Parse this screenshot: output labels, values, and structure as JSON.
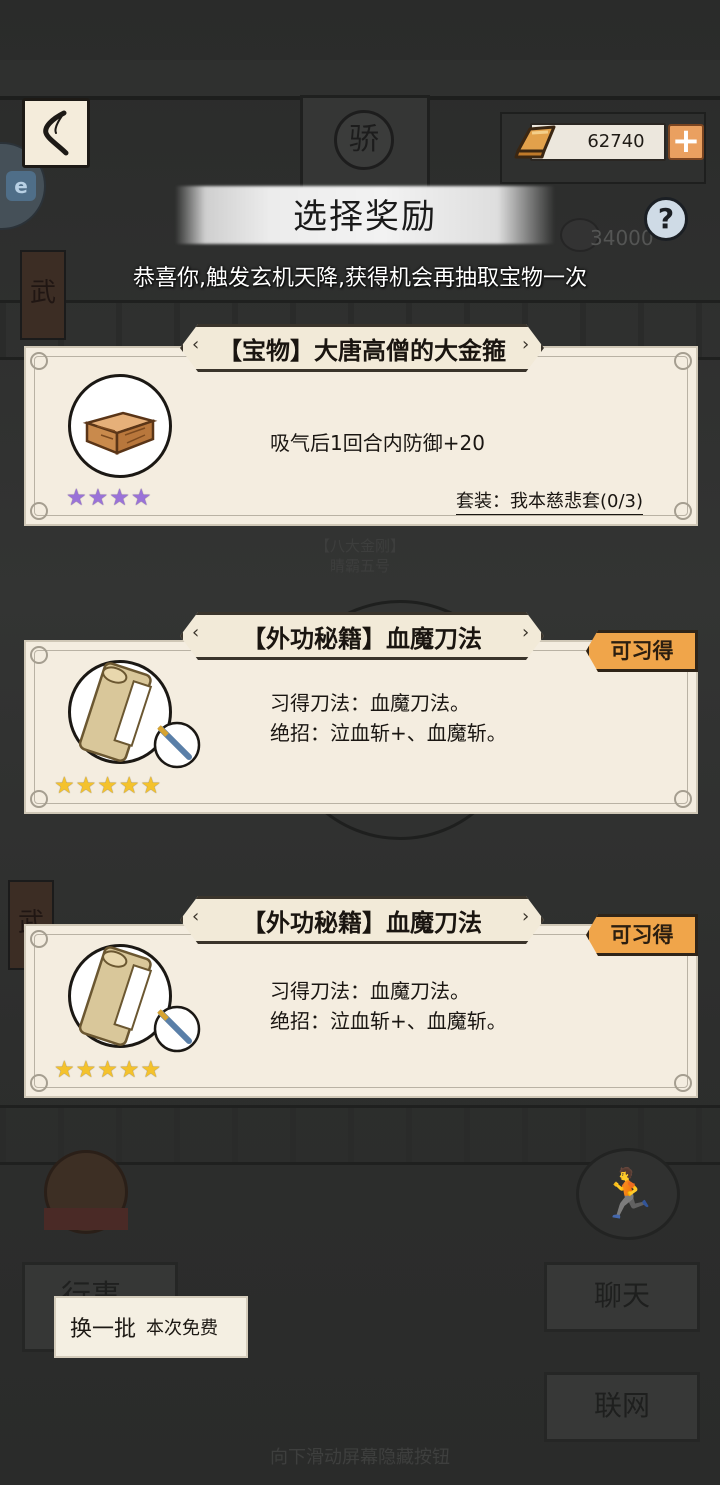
{
  "header": {
    "currency_value": "62740",
    "gate_plaque_char": "骄"
  },
  "title": {
    "text": "选择奖励",
    "subtitle": "恭喜你,触发玄机天降,获得机会再抽取宝物一次",
    "faded_note": "34000"
  },
  "background": {
    "banner_char": "武",
    "character_title": "【八大金刚】",
    "character_name": "睛霸五号",
    "left_button": "行事",
    "chat_button": "聊天",
    "network_button": "联网",
    "swipe_hint": "向下滑动屏幕隐藏按钮"
  },
  "rewards": [
    {
      "title": "【宝物】大唐高僧的大金箍",
      "icon": "treasure-box-icon",
      "stars": 4,
      "star_color": "#9a72d8",
      "description": "吸气后1回合内防御+20",
      "set_text": "套装：我本慈悲套(0/3)",
      "badge": ""
    },
    {
      "title": "【外功秘籍】血魔刀法",
      "icon": "scroll-with-blade-icon",
      "stars": 5,
      "star_color": "#f4c22c",
      "description": "习得刀法：血魔刀法。\n绝招：泣血斩+、血魔斩。",
      "set_text": "",
      "badge": "可习得"
    },
    {
      "title": "【外功秘籍】血魔刀法",
      "icon": "scroll-with-blade-icon",
      "stars": 5,
      "star_color": "#f4c22c",
      "description": "习得刀法：血魔刀法。\n绝招：泣血斩+、血魔斩。",
      "set_text": "",
      "badge": "可习得"
    }
  ],
  "refresh": {
    "label": "换一批",
    "note": "本次免费"
  },
  "colors": {
    "card_bg": "#f4ede0",
    "badge_orange": "#f0a54a",
    "overlay": "#2c2d2c"
  }
}
